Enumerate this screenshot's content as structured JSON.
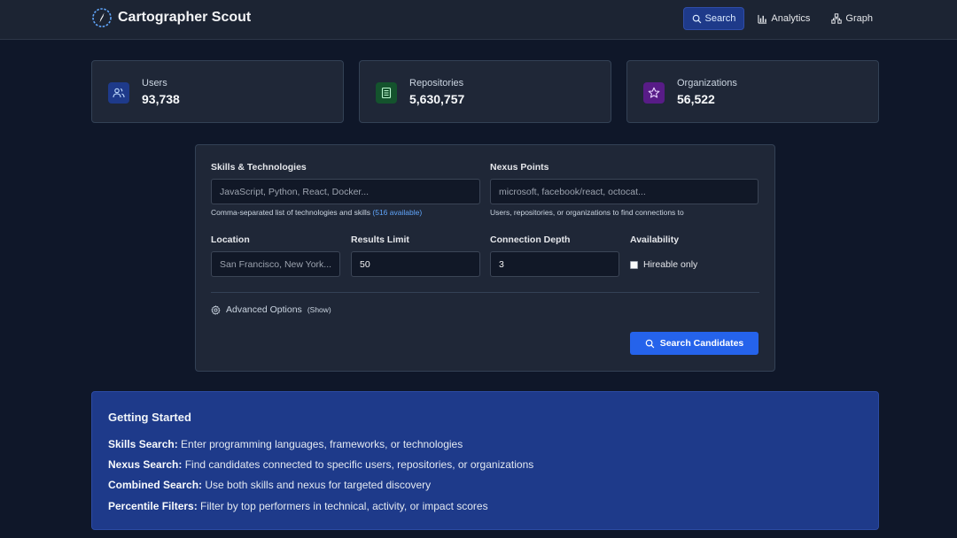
{
  "app": {
    "title": "Cartographer Scout",
    "icons": {
      "brand": "compass-icon"
    }
  },
  "nav": {
    "items": [
      {
        "label": "Search",
        "icon": "search-icon",
        "active": true
      },
      {
        "label": "Analytics",
        "icon": "bar-chart-icon",
        "active": false
      },
      {
        "label": "Graph",
        "icon": "graph-icon",
        "active": false
      }
    ]
  },
  "stats": [
    {
      "label": "Users",
      "value": "93,738",
      "icon": "users-icon",
      "color": "#1e3a8a"
    },
    {
      "label": "Repositories",
      "value": "5,630,757",
      "icon": "repository-icon",
      "color": "#14532d"
    },
    {
      "label": "Organizations",
      "value": "56,522",
      "icon": "star-icon",
      "color": "#581c87"
    }
  ],
  "form": {
    "skills": {
      "label": "Skills & Technologies",
      "placeholder": "JavaScript, Python, React, Docker...",
      "hint": "Comma-separated list of technologies and skills",
      "hint_link": "(516 available)"
    },
    "nexus": {
      "label": "Nexus Points",
      "placeholder": "microsoft, facebook/react, octocat...",
      "hint": "Users, repositories, or organizations to find connections to"
    },
    "location": {
      "label": "Location",
      "placeholder": "San Francisco, New York..."
    },
    "limit": {
      "label": "Results Limit",
      "value": "50"
    },
    "depth": {
      "label": "Connection Depth",
      "value": "3"
    },
    "availability": {
      "label": "Availability",
      "checkbox_label": "Hireable only",
      "checked": false
    },
    "advanced": {
      "label": "Advanced Options",
      "toggle": "(Show)"
    },
    "submit_label": "Search Candidates"
  },
  "guide": {
    "title": "Getting Started",
    "items": [
      {
        "term": "Skills Search:",
        "text": " Enter programming languages, frameworks, or technologies"
      },
      {
        "term": "Nexus Search:",
        "text": " Find candidates connected to specific users, repositories, or organizations"
      },
      {
        "term": "Combined Search:",
        "text": " Use both skills and nexus for targeted discovery"
      },
      {
        "term": "Percentile Filters:",
        "text": " Filter by top performers in technical, activity, or impact scores"
      }
    ]
  },
  "colors": {
    "accent": "#2563eb",
    "background": "#0f1729",
    "panel": "#1f2737",
    "guide": "#1e3a8a"
  }
}
